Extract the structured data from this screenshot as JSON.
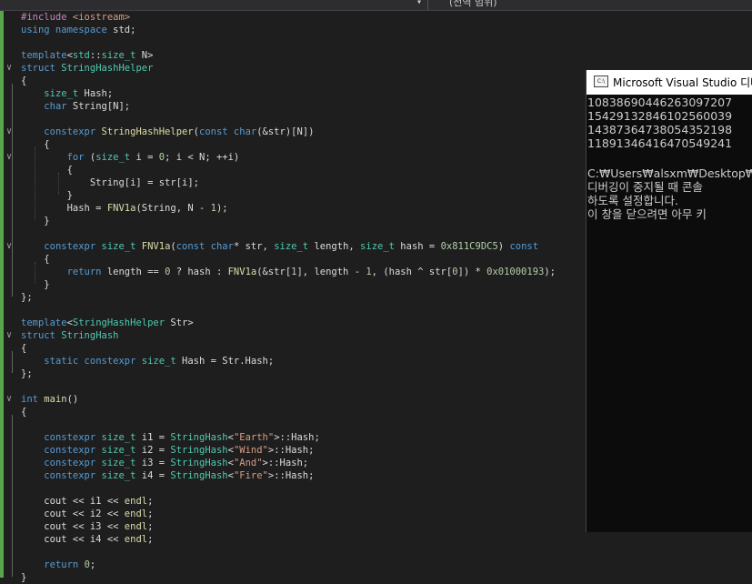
{
  "toolbar": {
    "dropdown_icon": "chevron-down-icon",
    "scope_label": "(전역 범위)"
  },
  "editor": {
    "lines": [
      [
        [
          "macro",
          "#include "
        ],
        [
          "str",
          "<iostream>"
        ]
      ],
      [
        [
          "kw",
          "using namespace "
        ],
        [
          "plain",
          "std;"
        ]
      ],
      [],
      [
        [
          "kw",
          "template"
        ],
        [
          "plain",
          "<"
        ],
        [
          "type",
          "std"
        ],
        [
          "plain",
          "::"
        ],
        [
          "type",
          "size_t"
        ],
        [
          "plain",
          " N>"
        ]
      ],
      [
        [
          "kw",
          "struct "
        ],
        [
          "type",
          "StringHashHelper"
        ]
      ],
      [
        [
          "plain",
          "{"
        ]
      ],
      [
        [
          "plain",
          "    "
        ],
        [
          "type",
          "size_t"
        ],
        [
          "plain",
          " Hash;"
        ]
      ],
      [
        [
          "plain",
          "    "
        ],
        [
          "kw",
          "char"
        ],
        [
          "plain",
          " String[N];"
        ]
      ],
      [],
      [
        [
          "plain",
          "    "
        ],
        [
          "kw",
          "constexpr "
        ],
        [
          "fn",
          "StringHashHelper"
        ],
        [
          "plain",
          "("
        ],
        [
          "kw",
          "const char"
        ],
        [
          "plain",
          "(&str)[N])"
        ]
      ],
      [
        [
          "plain",
          "    {"
        ]
      ],
      [
        [
          "plain",
          "        "
        ],
        [
          "kw",
          "for"
        ],
        [
          "plain",
          " ("
        ],
        [
          "type",
          "size_t"
        ],
        [
          "plain",
          " i = "
        ],
        [
          "num",
          "0"
        ],
        [
          "plain",
          "; i < N; ++i)"
        ]
      ],
      [
        [
          "plain",
          "        {"
        ]
      ],
      [
        [
          "plain",
          "            String[i] = str[i];"
        ]
      ],
      [
        [
          "plain",
          "        }"
        ]
      ],
      [
        [
          "plain",
          "        Hash = "
        ],
        [
          "fn",
          "FNV1a"
        ],
        [
          "plain",
          "(String, N - "
        ],
        [
          "num",
          "1"
        ],
        [
          "plain",
          ");"
        ]
      ],
      [
        [
          "plain",
          "    }"
        ]
      ],
      [],
      [
        [
          "plain",
          "    "
        ],
        [
          "kw",
          "constexpr "
        ],
        [
          "type",
          "size_t"
        ],
        [
          "plain",
          " "
        ],
        [
          "fn",
          "FNV1a"
        ],
        [
          "plain",
          "("
        ],
        [
          "kw",
          "const char"
        ],
        [
          "plain",
          "* str, "
        ],
        [
          "type",
          "size_t"
        ],
        [
          "plain",
          " length, "
        ],
        [
          "type",
          "size_t"
        ],
        [
          "plain",
          " hash = "
        ],
        [
          "num",
          "0x811C9DC5"
        ],
        [
          "plain",
          ") "
        ],
        [
          "kw",
          "const"
        ]
      ],
      [
        [
          "plain",
          "    {"
        ]
      ],
      [
        [
          "plain",
          "        "
        ],
        [
          "kw",
          "return"
        ],
        [
          "plain",
          " length == "
        ],
        [
          "num",
          "0"
        ],
        [
          "plain",
          " ? hash : "
        ],
        [
          "fn",
          "FNV1a"
        ],
        [
          "plain",
          "(&str["
        ],
        [
          "num",
          "1"
        ],
        [
          "plain",
          "], length - "
        ],
        [
          "num",
          "1"
        ],
        [
          "plain",
          ", (hash ^ str["
        ],
        [
          "num",
          "0"
        ],
        [
          "plain",
          "]) * "
        ],
        [
          "num",
          "0x01000193"
        ],
        [
          "plain",
          ");"
        ]
      ],
      [
        [
          "plain",
          "    }"
        ]
      ],
      [
        [
          "plain",
          "};"
        ]
      ],
      [],
      [
        [
          "kw",
          "template"
        ],
        [
          "plain",
          "<"
        ],
        [
          "type",
          "StringHashHelper"
        ],
        [
          "plain",
          " Str>"
        ]
      ],
      [
        [
          "kw",
          "struct "
        ],
        [
          "type",
          "StringHash"
        ]
      ],
      [
        [
          "plain",
          "{"
        ]
      ],
      [
        [
          "plain",
          "    "
        ],
        [
          "kw",
          "static constexpr "
        ],
        [
          "type",
          "size_t"
        ],
        [
          "plain",
          " Hash = Str.Hash;"
        ]
      ],
      [
        [
          "plain",
          "};"
        ]
      ],
      [],
      [
        [
          "kw",
          "int "
        ],
        [
          "fn",
          "main"
        ],
        [
          "plain",
          "()"
        ]
      ],
      [
        [
          "plain",
          "{"
        ]
      ],
      [],
      [
        [
          "plain",
          "    "
        ],
        [
          "kw",
          "constexpr "
        ],
        [
          "type",
          "size_t"
        ],
        [
          "plain",
          " i1 = "
        ],
        [
          "type",
          "StringHash"
        ],
        [
          "plain",
          "<"
        ],
        [
          "str",
          "\"Earth\""
        ],
        [
          "plain",
          ">::Hash;"
        ]
      ],
      [
        [
          "plain",
          "    "
        ],
        [
          "kw",
          "constexpr "
        ],
        [
          "type",
          "size_t"
        ],
        [
          "plain",
          " i2 = "
        ],
        [
          "type",
          "StringHash"
        ],
        [
          "plain",
          "<"
        ],
        [
          "str",
          "\"Wind\""
        ],
        [
          "plain",
          ">::Hash;"
        ]
      ],
      [
        [
          "plain",
          "    "
        ],
        [
          "kw",
          "constexpr "
        ],
        [
          "type",
          "size_t"
        ],
        [
          "plain",
          " i3 = "
        ],
        [
          "type",
          "StringHash"
        ],
        [
          "plain",
          "<"
        ],
        [
          "str",
          "\"And\""
        ],
        [
          "plain",
          ">::Hash;"
        ]
      ],
      [
        [
          "plain",
          "    "
        ],
        [
          "kw",
          "constexpr "
        ],
        [
          "type",
          "size_t"
        ],
        [
          "plain",
          " i4 = "
        ],
        [
          "type",
          "StringHash"
        ],
        [
          "plain",
          "<"
        ],
        [
          "str",
          "\"Fire\""
        ],
        [
          "plain",
          ">::Hash;"
        ]
      ],
      [],
      [
        [
          "plain",
          "    cout << i1 << "
        ],
        [
          "fn",
          "endl"
        ],
        [
          "plain",
          ";"
        ]
      ],
      [
        [
          "plain",
          "    cout << i2 << "
        ],
        [
          "fn",
          "endl"
        ],
        [
          "plain",
          ";"
        ]
      ],
      [
        [
          "plain",
          "    cout << i3 << "
        ],
        [
          "fn",
          "endl"
        ],
        [
          "plain",
          ";"
        ]
      ],
      [
        [
          "plain",
          "    cout << i4 << "
        ],
        [
          "fn",
          "endl"
        ],
        [
          "plain",
          ";"
        ]
      ],
      [],
      [
        [
          "plain",
          "    "
        ],
        [
          "kw",
          "return "
        ],
        [
          "num",
          "0"
        ],
        [
          "plain",
          ";"
        ]
      ],
      [
        [
          "plain",
          "}"
        ]
      ]
    ],
    "fold_markers": [
      {
        "line": 4,
        "glyph": "∨"
      },
      {
        "line": 9,
        "glyph": "∨"
      },
      {
        "line": 11,
        "glyph": "∨"
      },
      {
        "line": 18,
        "glyph": "∨"
      },
      {
        "line": 25,
        "glyph": "∨"
      },
      {
        "line": 30,
        "glyph": "∨"
      }
    ]
  },
  "console": {
    "icon": "console-app-icon",
    "icon_label": "C:\\",
    "title": "Microsoft Visual Studio 디버",
    "lines": [
      "10838690446263097207",
      "15429132846102560039",
      "14387364738054352198",
      "11891346416470549241",
      "",
      "C:₩Users₩alsxm₩Desktop₩",
      "디버깅이 중지될 때 콘솔",
      "하도록 설정합니다.",
      "이 창을 닫으려면 아무 키"
    ]
  }
}
